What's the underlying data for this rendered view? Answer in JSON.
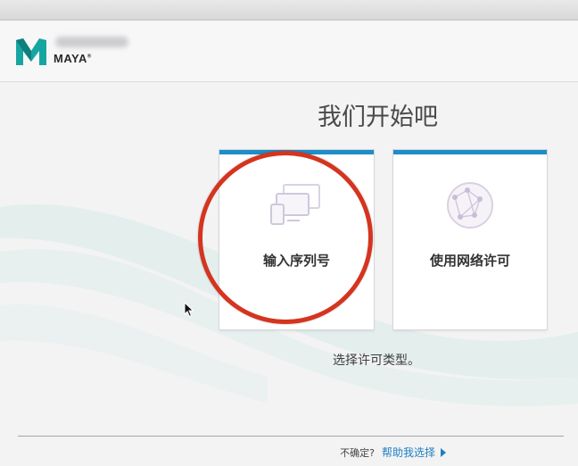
{
  "app": {
    "name": "MAYA"
  },
  "page": {
    "heading": "我们开始吧",
    "subtitle": "选择许可类型。"
  },
  "options": {
    "serial": {
      "label": "输入序列号",
      "icon": "monitors-icon"
    },
    "network": {
      "label": "使用网络许可",
      "icon": "globe-network-icon"
    }
  },
  "footer": {
    "question": "不确定?",
    "help_link": "帮助我选择"
  },
  "colors": {
    "accent": "#1f8dc8",
    "highlight_circle": "#d5341f",
    "link": "#1f7fc0",
    "logo_teal": "#17a5a1"
  }
}
